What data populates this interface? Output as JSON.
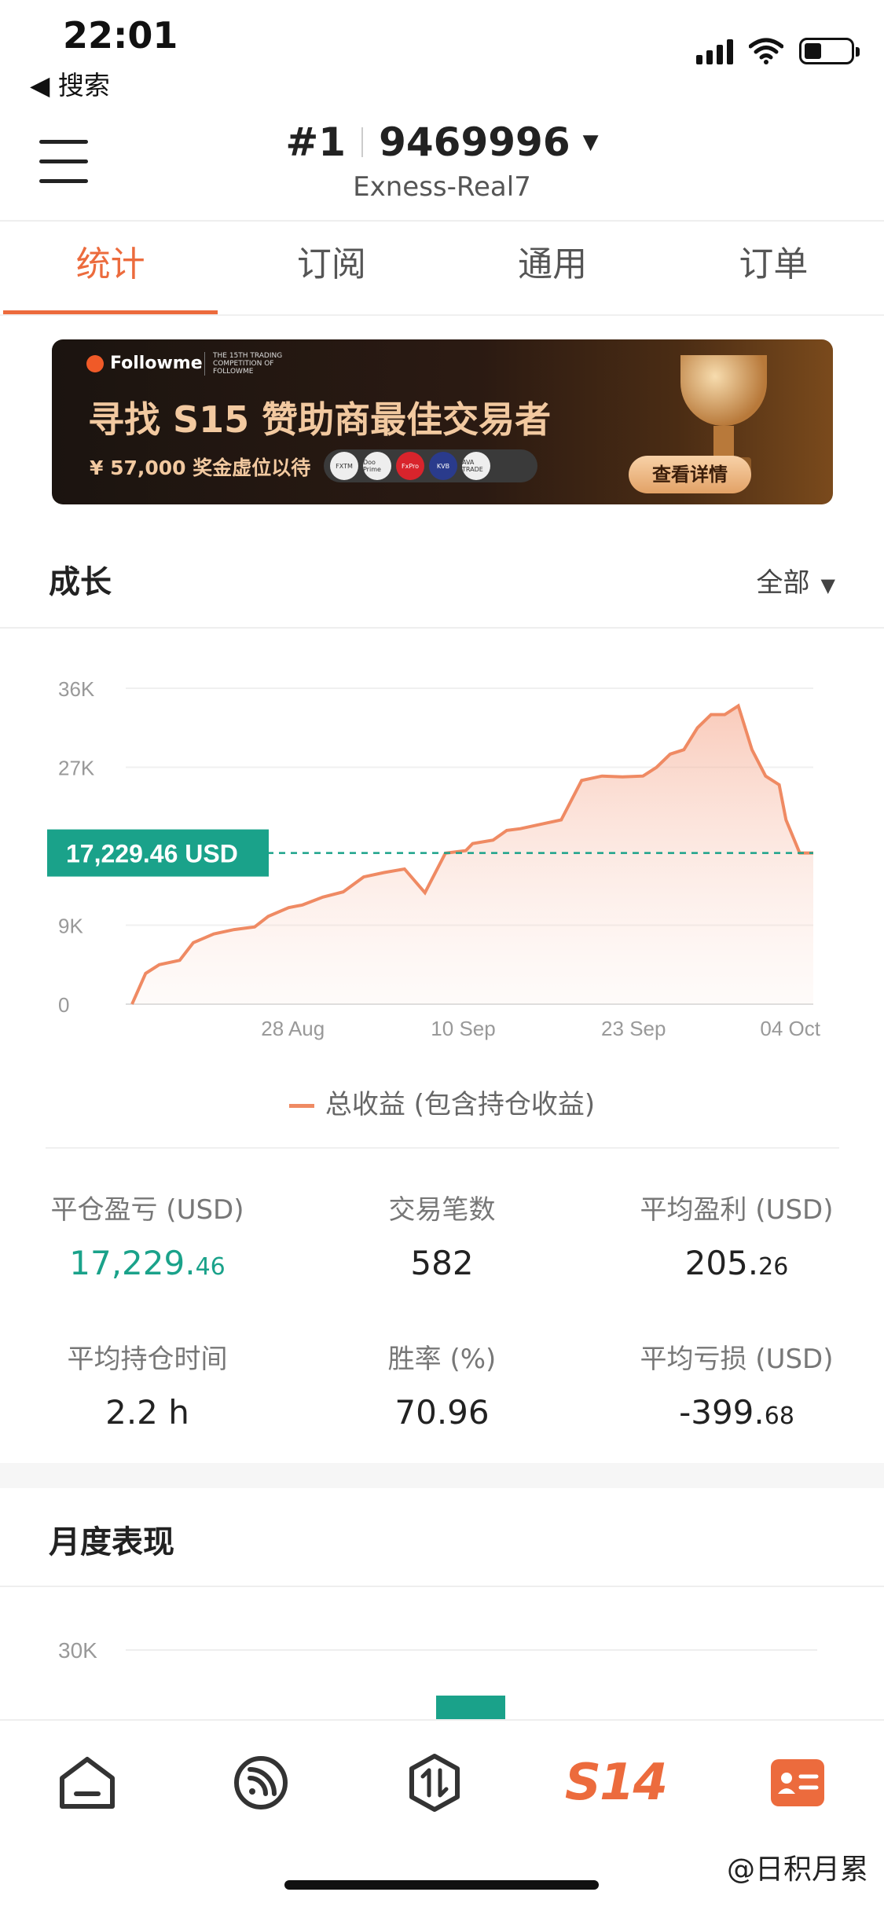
{
  "status": {
    "time": "22:01",
    "back_label": "◀ 搜索"
  },
  "header": {
    "rank": "#1",
    "account": "9469996",
    "server": "Exness-Real7"
  },
  "tabs": [
    "统计",
    "订阅",
    "通用",
    "订单"
  ],
  "active_tab": 0,
  "banner": {
    "brand": "Followme",
    "competition_text": "THE 15TH TRADING COMPETITION OF FOLLOWME",
    "title": "寻找 S15 赞助商最佳交易者",
    "prize": "¥ 57,000 奖金虚位以待",
    "sponsors": [
      "FXTM",
      "Doo Prime",
      "FxPro",
      "KVB",
      "AVA TRADE"
    ],
    "button": "查看详情"
  },
  "growth": {
    "title": "成长",
    "filter": "全部",
    "current_value_label": "17,229.46 USD",
    "legend": "总收益 (包含持仓收益)"
  },
  "chart_data": {
    "type": "area",
    "title": "",
    "xlabel": "",
    "ylabel": "",
    "ylim": [
      0,
      36000
    ],
    "y_ticks": [
      "0",
      "9K",
      "27K",
      "36K"
    ],
    "x_ticks": [
      "28 Aug",
      "10 Sep",
      "23 Sep",
      "04 Oct"
    ],
    "reference_line": 17229.46,
    "series": [
      {
        "name": "总收益 (包含持仓收益)",
        "color": "#ef8a63",
        "x": [
          0,
          0.02,
          0.04,
          0.07,
          0.09,
          0.12,
          0.15,
          0.18,
          0.2,
          0.23,
          0.25,
          0.28,
          0.31,
          0.34,
          0.37,
          0.4,
          0.43,
          0.46,
          0.49,
          0.5,
          0.53,
          0.55,
          0.57,
          0.6,
          0.63,
          0.66,
          0.69,
          0.72,
          0.75,
          0.77,
          0.79,
          0.81,
          0.83,
          0.85,
          0.87,
          0.89,
          0.91,
          0.93,
          0.95,
          0.96,
          0.98,
          1.0
        ],
        "values": [
          0,
          3500,
          4500,
          5000,
          7000,
          8000,
          8500,
          8800,
          10000,
          11000,
          11300,
          12200,
          12800,
          14500,
          15000,
          15400,
          12700,
          17200,
          17500,
          18300,
          18700,
          19800,
          20000,
          20500,
          21000,
          25500,
          26000,
          25900,
          26000,
          27000,
          28500,
          29000,
          31500,
          33000,
          33000,
          34000,
          29000,
          26000,
          25000,
          21000,
          17229.46,
          17229.46
        ]
      }
    ]
  },
  "stats": [
    [
      {
        "label": "平仓盈亏 (USD)",
        "value": "17,229.",
        "decimals": "46",
        "green": true
      },
      {
        "label": "交易笔数",
        "value": "582",
        "decimals": "",
        "green": false
      },
      {
        "label": "平均盈利 (USD)",
        "value": "205.",
        "decimals": "26",
        "green": false
      }
    ],
    [
      {
        "label": "平均持仓时间",
        "value": "2.2 h",
        "decimals": "",
        "green": false
      },
      {
        "label": "胜率 (%)",
        "value": "70.96",
        "decimals": "",
        "green": false
      },
      {
        "label": "平均亏损 (USD)",
        "value": "-399.",
        "decimals": "68",
        "green": false
      }
    ]
  ],
  "monthly": {
    "title": "月度表现",
    "y_tick": "30K"
  },
  "bottom_nav": [
    "home-icon",
    "feed-icon",
    "trade-icon",
    "S14",
    "profile-card-icon"
  ],
  "watermark": "@日积月累",
  "colors": {
    "accent": "#ec6b3d",
    "green": "#1aa28a",
    "line": "#ef8a63"
  }
}
